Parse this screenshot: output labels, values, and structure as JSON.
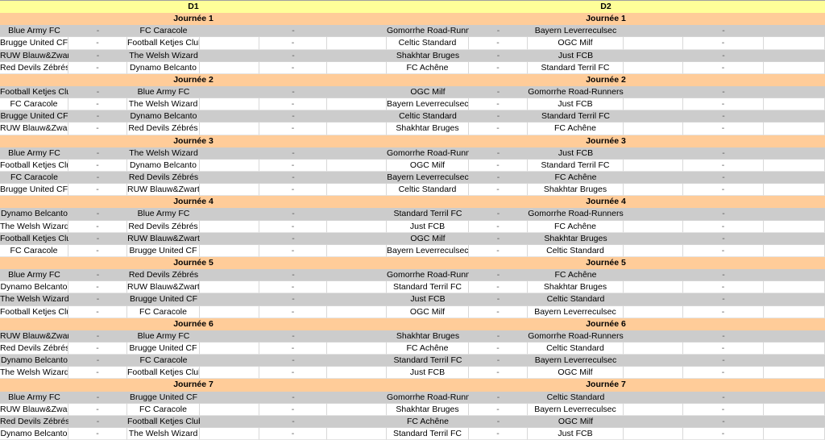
{
  "divisions": [
    {
      "label": "D1"
    },
    {
      "label": "D2"
    }
  ],
  "separator": "-",
  "journees": [
    {
      "label": "Journée 1",
      "d1": [
        [
          "Blue Army FC",
          "FC Caracole"
        ],
        [
          "Brugge United CF",
          "Football Ketjes Club"
        ],
        [
          "RUW Blauw&Zwart",
          "The Welsh Wizard"
        ],
        [
          "Red Devils Zébrés",
          "Dynamo Belcanto"
        ]
      ],
      "d2": [
        [
          "Gomorrhe Road-Runner",
          "Bayern Leverreculsec"
        ],
        [
          "Celtic Standard",
          "OGC Milf"
        ],
        [
          "Shakhtar Bruges",
          "Just FCB"
        ],
        [
          "FC Achêne",
          "Standard Terril FC"
        ]
      ]
    },
    {
      "label": "Journée 2",
      "d1": [
        [
          "Football Ketjes Club",
          "Blue Army FC"
        ],
        [
          "FC Caracole",
          "The Welsh Wizard"
        ],
        [
          "Brugge United CF",
          "Dynamo Belcanto"
        ],
        [
          "RUW Blauw&Zwart",
          "Red Devils Zébrés"
        ]
      ],
      "d2": [
        [
          "OGC Milf",
          "Gomorrhe Road-Runners"
        ],
        [
          "Bayern Leverreculsec",
          "Just FCB"
        ],
        [
          "Celtic Standard",
          "Standard Terril FC"
        ],
        [
          "Shakhtar Bruges",
          "FC Achêne"
        ]
      ]
    },
    {
      "label": "Journée 3",
      "d1": [
        [
          "Blue Army FC",
          "The Welsh Wizard"
        ],
        [
          "Football Ketjes Club",
          "Dynamo Belcanto"
        ],
        [
          "FC Caracole",
          "Red Devils Zébrés"
        ],
        [
          "Brugge United CF",
          "RUW Blauw&Zwart"
        ]
      ],
      "d2": [
        [
          "Gomorrhe Road-Runner",
          "Just FCB"
        ],
        [
          "OGC Milf",
          "Standard Terril FC"
        ],
        [
          "Bayern Leverreculsec",
          "FC Achêne"
        ],
        [
          "Celtic Standard",
          "Shakhtar Bruges"
        ]
      ]
    },
    {
      "label": "Journée 4",
      "d1": [
        [
          "Dynamo Belcanto",
          "Blue Army FC"
        ],
        [
          "The Welsh Wizard",
          "Red Devils Zébrés"
        ],
        [
          "Football Ketjes Club",
          "RUW Blauw&Zwart"
        ],
        [
          "FC Caracole",
          "Brugge United CF"
        ]
      ],
      "d2": [
        [
          "Standard Terril FC",
          "Gomorrhe Road-Runners"
        ],
        [
          "Just FCB",
          "FC Achêne"
        ],
        [
          "OGC Milf",
          "Shakhtar Bruges"
        ],
        [
          "Bayern Leverreculsec",
          "Celtic Standard"
        ]
      ]
    },
    {
      "label": "Journée 5",
      "d1": [
        [
          "Blue Army FC",
          "Red Devils Zébrés"
        ],
        [
          "Dynamo Belcanto",
          "RUW Blauw&Zwart"
        ],
        [
          "The Welsh Wizard",
          "Brugge United CF"
        ],
        [
          "Football Ketjes Club",
          "FC Caracole"
        ]
      ],
      "d2": [
        [
          "Gomorrhe Road-Runner",
          "FC Achêne"
        ],
        [
          "Standard Terril FC",
          "Shakhtar Bruges"
        ],
        [
          "Just FCB",
          "Celtic Standard"
        ],
        [
          "OGC Milf",
          "Bayern Leverreculsec"
        ]
      ]
    },
    {
      "label": "Journée 6",
      "d1": [
        [
          "RUW Blauw&Zwart",
          "Blue Army FC"
        ],
        [
          "Red Devils Zébrés",
          "Brugge United CF"
        ],
        [
          "Dynamo Belcanto",
          "FC Caracole"
        ],
        [
          "The Welsh Wizard",
          "Football Ketjes Club"
        ]
      ],
      "d2": [
        [
          "Shakhtar Bruges",
          "Gomorrhe Road-Runners"
        ],
        [
          "FC Achêne",
          "Celtic Standard"
        ],
        [
          "Standard Terril FC",
          "Bayern Leverreculsec"
        ],
        [
          "Just FCB",
          "OGC Milf"
        ]
      ]
    },
    {
      "label": "Journée 7",
      "d1": [
        [
          "Blue Army FC",
          "Brugge United CF"
        ],
        [
          "RUW Blauw&Zwart",
          "FC Caracole"
        ],
        [
          "Red Devils Zébrés",
          "Football Ketjes Club"
        ],
        [
          "Dynamo Belcanto",
          "The Welsh Wizard"
        ]
      ],
      "d2": [
        [
          "Gomorrhe Road-Runner",
          "Celtic Standard"
        ],
        [
          "Shakhtar Bruges",
          "Bayern Leverreculsec"
        ],
        [
          "FC Achêne",
          "OGC Milf"
        ],
        [
          "Standard Terril FC",
          "Just FCB"
        ]
      ]
    }
  ],
  "colors": {
    "header_bg": "#ffff99",
    "journee_bg": "#ffcc99",
    "row_gray": "#cccccc",
    "row_white": "#ffffff"
  }
}
